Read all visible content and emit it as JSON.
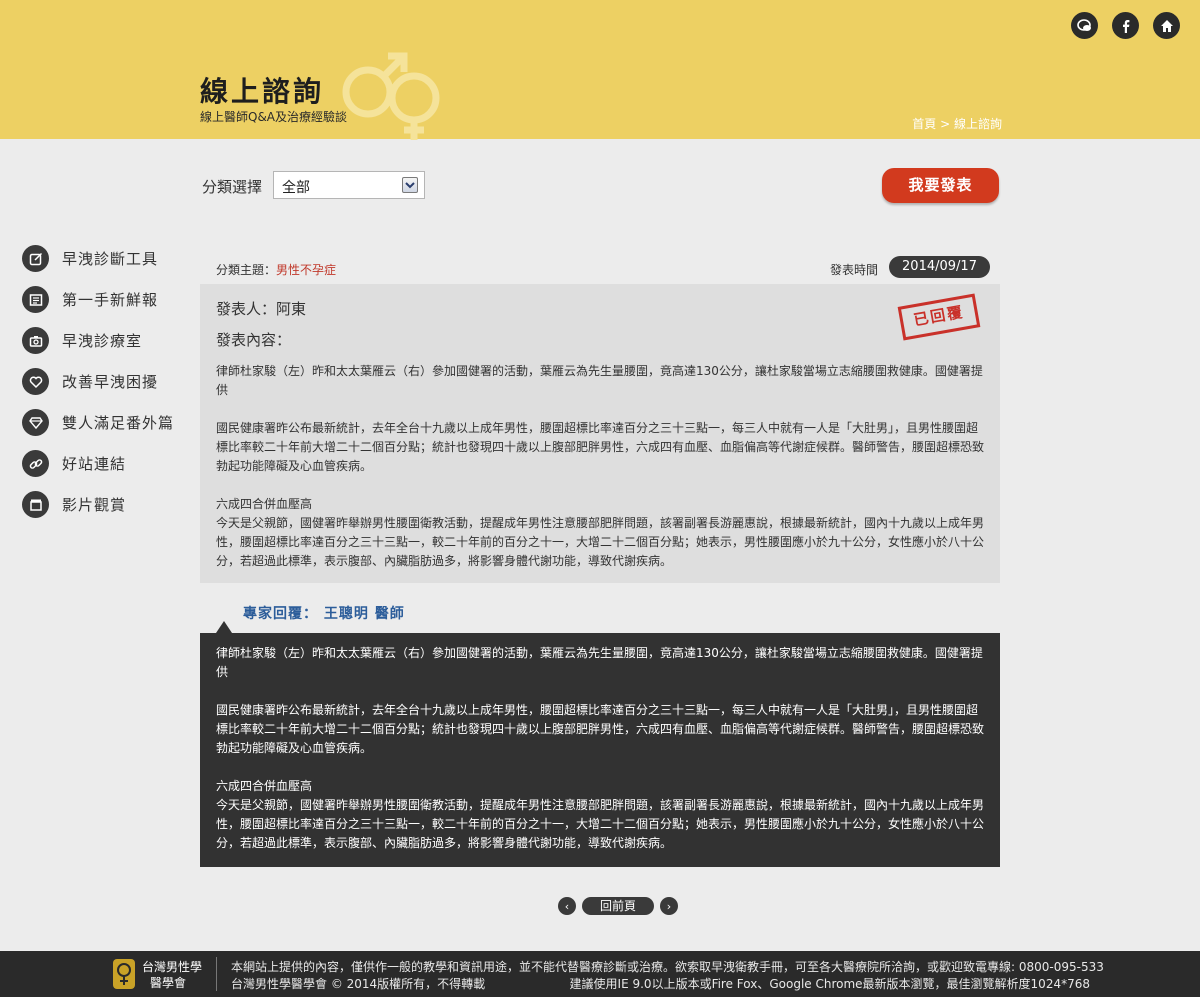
{
  "header": {
    "title": "線上諮詢",
    "subtitle": "線上醫師Q&A及治療經驗談",
    "breadcrumb_home": "首頁",
    "breadcrumb_sep": " > ",
    "breadcrumb_current": "線上諮詢"
  },
  "top_icons": [
    "chat-icon",
    "facebook-icon",
    "home-icon"
  ],
  "filter": {
    "label": "分類選擇",
    "selected": "全部"
  },
  "post_button": "我要發表",
  "sidebar": {
    "items": [
      {
        "label": "早洩診斷工具",
        "icon": "edit-icon"
      },
      {
        "label": "第一手新鮮報",
        "icon": "news-icon"
      },
      {
        "label": "早洩診療室",
        "icon": "camera-icon"
      },
      {
        "label": "改善早洩困擾",
        "icon": "heart-icon"
      },
      {
        "label": "雙人滿足番外篇",
        "icon": "diamond-icon"
      },
      {
        "label": "好站連結",
        "icon": "link-icon"
      },
      {
        "label": "影片觀賞",
        "icon": "film-icon"
      }
    ]
  },
  "post": {
    "category_label": "分類主題：",
    "category": "男性不孕症",
    "time_label": "發表時間",
    "date": "2014/09/17",
    "author": "發表人：阿東",
    "content_label": "發表內容：",
    "stamp": "已回覆",
    "paragraphs": [
      "律師杜家駿（左）昨和太太葉雁云（右）參加國健署的活動，葉雁云為先生量腰圍，竟高達130公分，讓杜家駿當場立志縮腰圍救健康。國健署提供",
      "國民健康署昨公布最新統計，去年全台十九歲以上成年男性，腰圍超標比率達百分之三十三點一，每三人中就有一人是「大肚男」，且男性腰圍超標比率較二十年前大增二十二個百分點；統計也發現四十歲以上腹部肥胖男性，六成四有血壓、血脂偏高等代謝症候群。醫師警告，腰圍超標恐致勃起功能障礙及心血管疾病。",
      "六成四合併血壓高\n今天是父親節，國健署昨舉辦男性腰圍衛教活動，提醒成年男性注意腰部肥胖問題，該署副署長游麗惠說，根據最新統計，國內十九歲以上成年男性，腰圍超標比率達百分之三十三點一，較二十年前的百分之十一，大增二十二個百分點；她表示，男性腰圍應小於九十公分，女性應小於八十公分，若超過此標準，表示腹部、內臟脂肪過多，將影響身體代謝功能，導致代謝疾病。"
    ]
  },
  "reply": {
    "heading": "專家回覆： 王聰明 醫師",
    "paragraphs": [
      "律師杜家駿（左）昨和太太葉雁云（右）參加國健署的活動，葉雁云為先生量腰圍，竟高達130公分，讓杜家駿當場立志縮腰圍救健康。國健署提供",
      "國民健康署昨公布最新統計，去年全台十九歲以上成年男性，腰圍超標比率達百分之三十三點一，每三人中就有一人是「大肚男」，且男性腰圍超標比率較二十年前大增二十二個百分點；統計也發現四十歲以上腹部肥胖男性，六成四有血壓、血脂偏高等代謝症候群。醫師警告，腰圍超標恐致勃起功能障礙及心血管疾病。",
      "六成四合併血壓高\n今天是父親節，國健署昨舉辦男性腰圍衛教活動，提醒成年男性注意腰部肥胖問題，該署副署長游麗惠說，根據最新統計，國內十九歲以上成年男性，腰圍超標比率達百分之三十三點一，較二十年前的百分之十一，大增二十二個百分點；她表示，男性腰圍應小於九十公分，女性應小於八十公分，若超過此標準，表示腹部、內臟脂肪過多，將影響身體代謝功能，導致代謝疾病。"
    ]
  },
  "pager": {
    "back": "回前頁",
    "prev": "‹",
    "next": "›"
  },
  "footer": {
    "org_line1": "台灣男性學",
    "org_line2": "醫學會",
    "line1": "本網站上提供的內容，僅供作一般的教學和資訊用途，並不能代替醫療診斷或治療。欲索取早洩衛教手冊，可至各大醫療院所洽詢，或歡迎致電專線: 0800-095-533",
    "line2_left": "台灣男性學醫學會 © 2014版權所有，不得轉載",
    "line2_right": "建議使用IE 9.0以上版本或Fire Fox、Google Chrome最新版本瀏覽，最佳瀏覽解析度1024*768"
  },
  "colors": {
    "header_bg": "#edd063",
    "accent_red": "#d23a1e",
    "expert_blue": "#2c5d9a",
    "dark": "#323232"
  }
}
